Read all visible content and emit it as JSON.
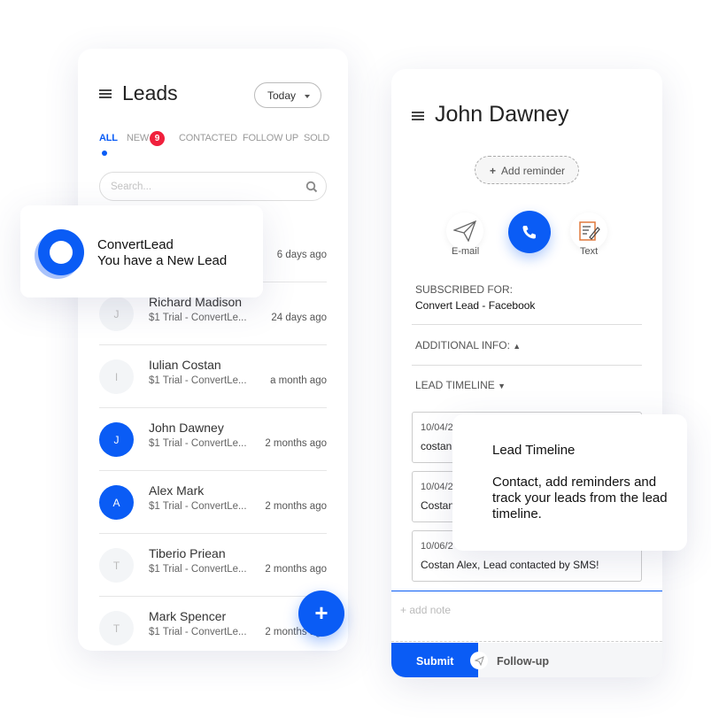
{
  "leads": {
    "title": "Leads",
    "filter": "Today",
    "tabs": [
      {
        "label": "ALL"
      },
      {
        "label": "NEW",
        "badge": "9"
      },
      {
        "label": "CONTACTED"
      },
      {
        "label": "FOLLOW UP"
      },
      {
        "label": "SOLD"
      }
    ],
    "search_placeholder": "Search...",
    "first_time": "6 days ago",
    "rows": [
      {
        "initial": "J",
        "name": "Richard Madison",
        "sub": "$1 Trial - ConvertLe...",
        "time": "24 days ago",
        "active": false
      },
      {
        "initial": "I",
        "name": "Iulian Costan",
        "sub": "$1 Trial - ConvertLe...",
        "time": "a month ago",
        "active": false
      },
      {
        "initial": "J",
        "name": "John Dawney",
        "sub": "$1 Trial - ConvertLe...",
        "time": "2 months ago",
        "active": true
      },
      {
        "initial": "A",
        "name": "Alex Mark",
        "sub": "$1 Trial - ConvertLe...",
        "time": "2 months ago",
        "active": true
      },
      {
        "initial": "T",
        "name": "Tiberio Priean",
        "sub": "$1 Trial - ConvertLe...",
        "time": "2 months ago",
        "active": false
      },
      {
        "initial": "T",
        "name": "Mark Spencer",
        "sub": "$1 Trial - ConvertLe...",
        "time": "2 months ago",
        "active": false
      }
    ],
    "fab": "+"
  },
  "notification": {
    "title": "ConvertLead",
    "message": "You have a New Lead"
  },
  "detail": {
    "name": "John Dawney",
    "add_reminder": "Add reminder",
    "email_label": "E-mail",
    "text_label": "Text",
    "subscribed_label": "SUBSCRIBED FOR:",
    "subscribed_value": "Convert Lead - Facebook",
    "additional_info": "ADDITIONAL INFO:",
    "lead_timeline": "LEAD TIMELINE",
    "timeline": [
      {
        "date": "10/04/2",
        "text": "costan."
      },
      {
        "date": "10/04/2",
        "text": "Costan"
      },
      {
        "date": "10/06/2",
        "text": "Costan Alex, Lead contacted by SMS!"
      }
    ],
    "note_placeholder": "+ add note",
    "submit": "Submit",
    "follow_up": "Follow-up"
  },
  "tooltip": {
    "title": "Lead Timeline",
    "body": "Contact, add reminders and track your leads from the lead timeline."
  },
  "colors": {
    "accent": "#0a5cf5",
    "badge": "#f0203c"
  }
}
